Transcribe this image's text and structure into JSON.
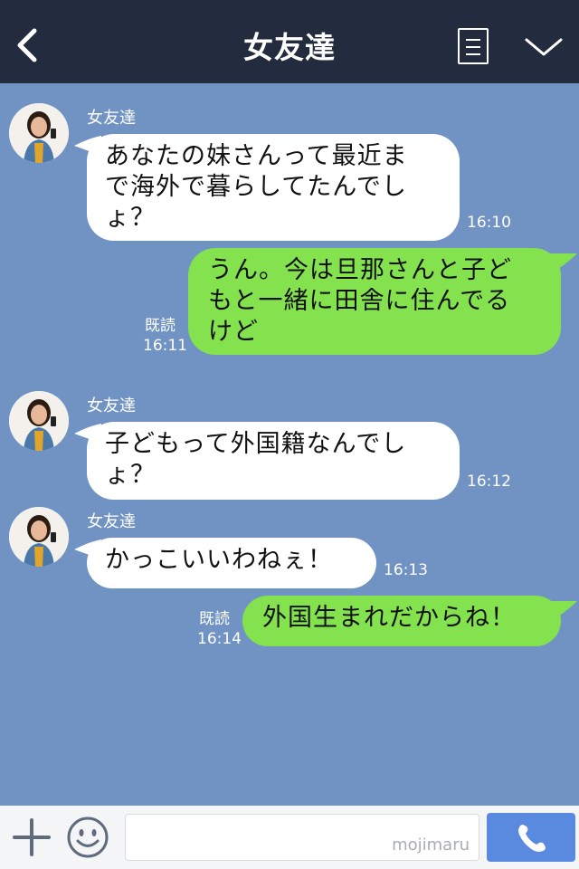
{
  "header": {
    "title": "女友達"
  },
  "messages": [
    {
      "direction": "in",
      "sender": "女友達",
      "lines": [
        "あなたの妹さんって最近ま",
        "で海外で暮らしてたんでし",
        "ょ？"
      ],
      "time": "16:10"
    },
    {
      "direction": "out",
      "lines": [
        "うん。今は旦那さんと子ど",
        "もと一緒に田舎に住んでる",
        "けど"
      ],
      "read": "既読",
      "time": "16:11"
    },
    {
      "direction": "in",
      "sender": "女友達",
      "lines": [
        "子どもって外国籍なんでし",
        "ょ？"
      ],
      "time": "16:12"
    },
    {
      "direction": "in",
      "sender": "女友達",
      "lines": [
        "かっこいいわねぇ！"
      ],
      "time": "16:13"
    },
    {
      "direction": "out",
      "lines": [
        "外国生まれだからね！"
      ],
      "read": "既読",
      "time": "16:14"
    }
  ],
  "footer": {
    "watermark": "mojimaru"
  },
  "colors": {
    "header_bg": "#232b3e",
    "chat_bg": "#7093c4",
    "incoming_bubble": "#ffffff",
    "outgoing_bubble": "#83e24d",
    "call_button": "#5a8ae0"
  },
  "icons": {
    "back": "back-icon",
    "menu": "menu-icon",
    "collapse": "chevron-down-icon",
    "add": "plus-icon",
    "emoji": "smile-icon",
    "call": "phone-icon"
  }
}
